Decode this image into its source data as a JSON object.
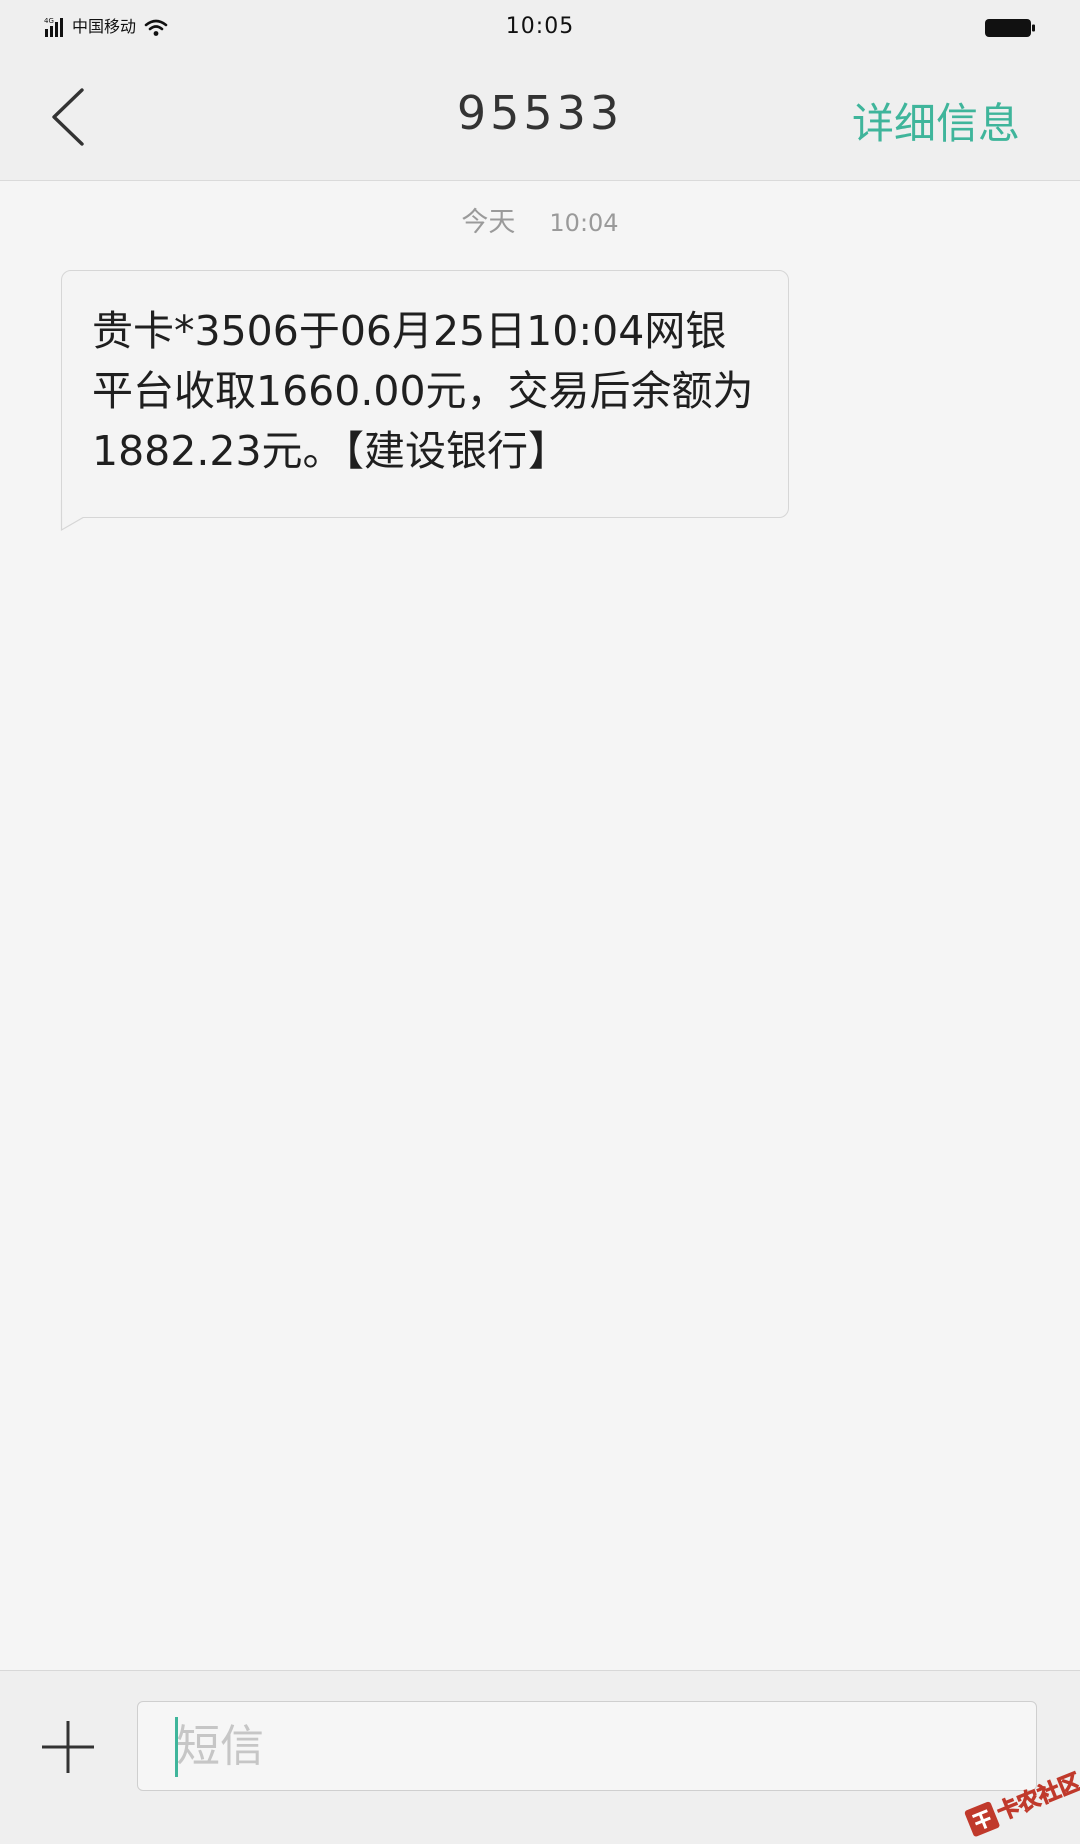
{
  "status_bar": {
    "carrier": "中国移动",
    "network": "4G",
    "time": "10:05"
  },
  "header": {
    "title": "95533",
    "details_label": "详细信息"
  },
  "thread": {
    "timestamp_day": "今天",
    "timestamp_time": "10:04",
    "messages": [
      {
        "direction": "incoming",
        "text": "贵卡*3506于06月25日10:04网银平台收取1660.00元，交易后余额为1882.23元。【建设银行】"
      }
    ]
  },
  "composer": {
    "placeholder": "短信"
  },
  "watermark": {
    "text": "卡农社区"
  },
  "colors": {
    "accent": "#3fb59b",
    "background": "#f5f5f5",
    "bar": "#efefef"
  }
}
